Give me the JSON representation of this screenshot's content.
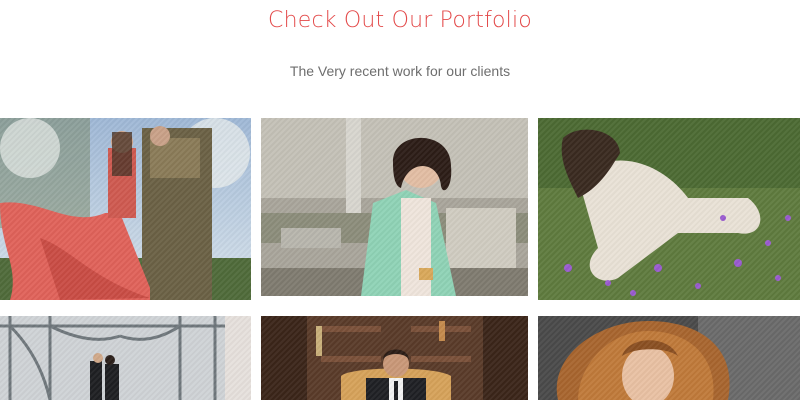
{
  "portfolio": {
    "title": "Check Out Our Portfolio",
    "subtitle": "The Very recent work for our clients",
    "accent_color": "#e34a4a"
  }
}
